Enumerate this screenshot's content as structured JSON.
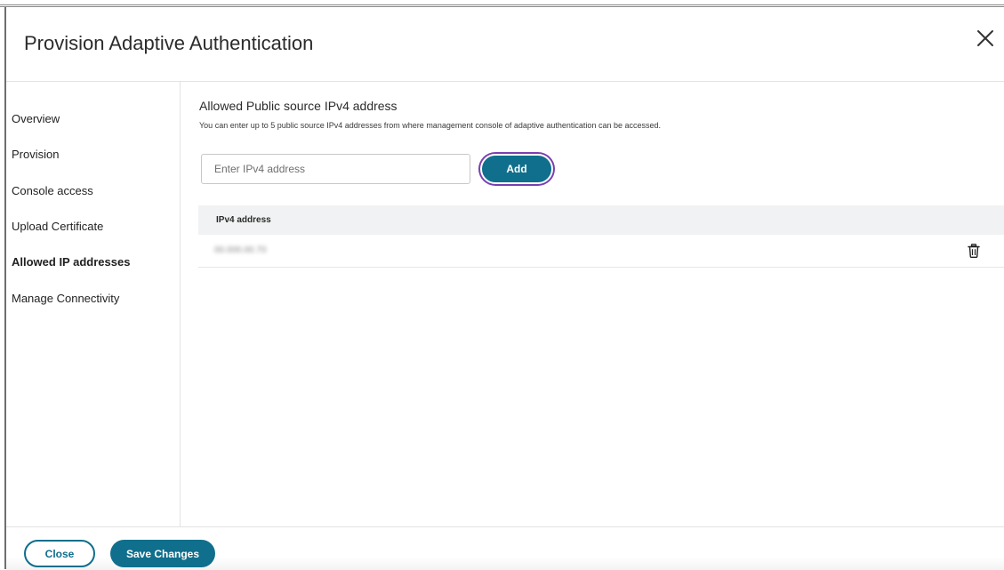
{
  "dialog": {
    "title": "Provision Adaptive Authentication",
    "close_icon": "close-icon"
  },
  "sidebar": {
    "items": [
      {
        "label": "Overview",
        "active": false
      },
      {
        "label": "Provision",
        "active": false
      },
      {
        "label": "Console access",
        "active": false
      },
      {
        "label": "Upload Certificate",
        "active": false
      },
      {
        "label": "Allowed IP addresses",
        "active": true
      },
      {
        "label": "Manage Connectivity",
        "active": false
      }
    ]
  },
  "main": {
    "section_title": "Allowed Public source IPv4 address",
    "description": "You can enter up to 5 public source IPv4 addresses from where management console of adaptive authentication can be accessed.",
    "input": {
      "placeholder": "Enter IPv4 address",
      "value": ""
    },
    "add_label": "Add",
    "table": {
      "header": "IPv4 address",
      "rows": [
        {
          "ip": "00.000.00.70",
          "delete_icon": "trash-icon"
        }
      ]
    }
  },
  "footer": {
    "close_label": "Close",
    "save_label": "Save Changes"
  },
  "colors": {
    "accent": "#0f6f8c",
    "focus_ring": "#7a3fb0",
    "table_header_bg": "#f1f2f3"
  }
}
